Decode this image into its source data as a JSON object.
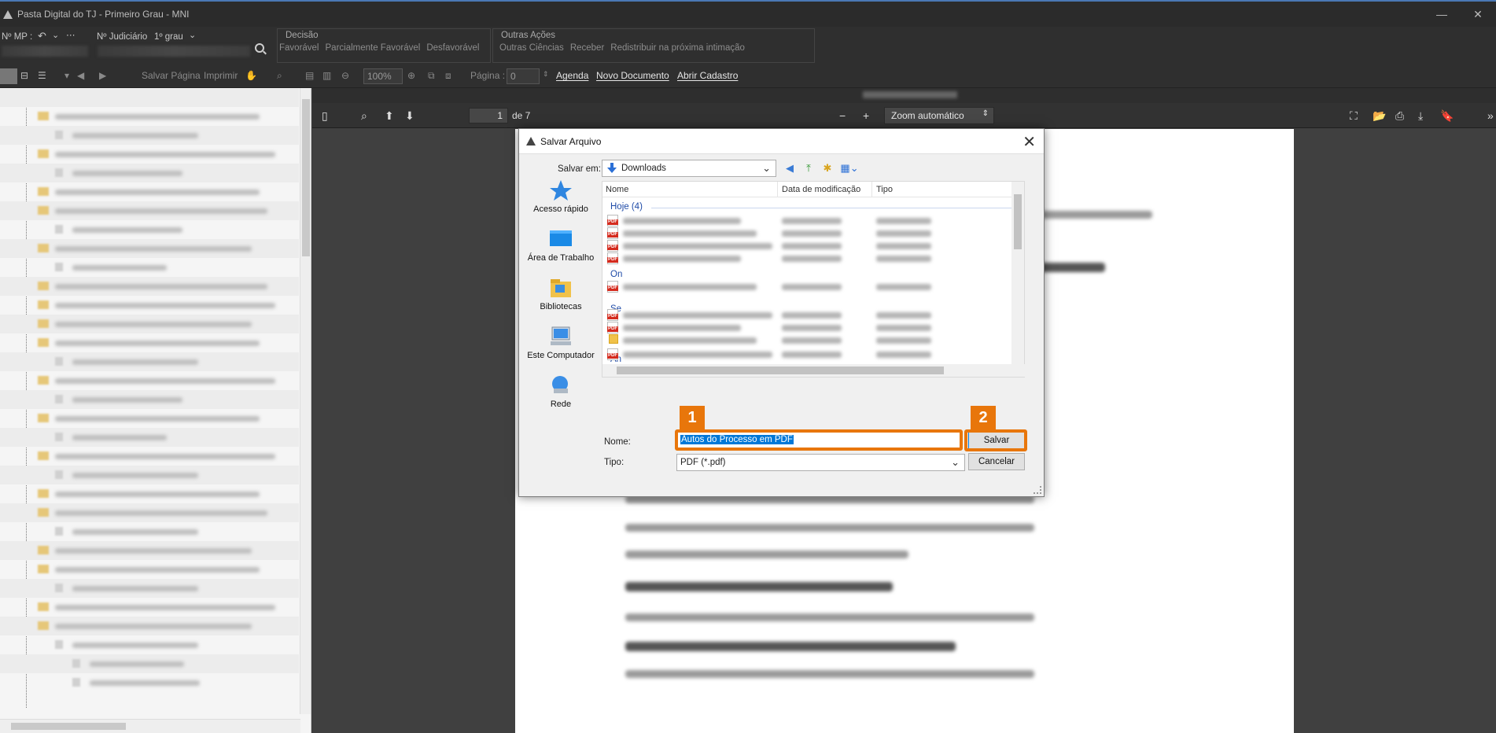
{
  "window": {
    "title": "Pasta Digital do TJ - Primeiro Grau - MNI",
    "minimize": "—",
    "close": "✕"
  },
  "ribbon": {
    "mp_label": "Nº MP :",
    "judiciario_label": "Nº Judiciário",
    "grau": "1º grau",
    "decisao": {
      "title": "Decisão",
      "items": [
        "Favorável",
        "Parcialmente Favorável",
        "Desfavorável"
      ]
    },
    "outras": {
      "title": "Outras Ações",
      "items": [
        "Outras Ciências",
        "Receber",
        "Redistribuir na próxima intimação"
      ]
    }
  },
  "toolbar": {
    "salvar_pagina": "Salvar Página",
    "imprimir": "Imprimir",
    "zoom": "100%",
    "pagina_label": "Página :",
    "pagina_value": "0",
    "agenda": "Agenda",
    "novo_documento": "Novo Documento",
    "abrir_cadastro": "Abrir Cadastro"
  },
  "pdfviewer": {
    "page": "1",
    "of": "de 7",
    "zoom": "Zoom automático"
  },
  "dialog": {
    "title": "Salvar Arquivo",
    "salvar_em_label": "Salvar em:",
    "salvar_em_value": "Downloads",
    "places": [
      "Acesso rápido",
      "Área de Trabalho",
      "Bibliotecas",
      "Este Computador",
      "Rede"
    ],
    "columns": [
      "Nome",
      "Data de modificação",
      "Tipo"
    ],
    "groups": [
      "Hoje (4)",
      "On",
      "Se",
      "An"
    ],
    "nome_label": "Nome:",
    "nome_value": "Autos do Processo em PDF",
    "tipo_label": "Tipo:",
    "tipo_value": "PDF (*.pdf)",
    "salvar": "Salvar",
    "cancelar": "Cancelar"
  },
  "callouts": [
    "1",
    "2"
  ],
  "colors": {
    "accent": "#e8760b",
    "selection": "#0078d7",
    "group_blue": "#1e4aa7"
  }
}
